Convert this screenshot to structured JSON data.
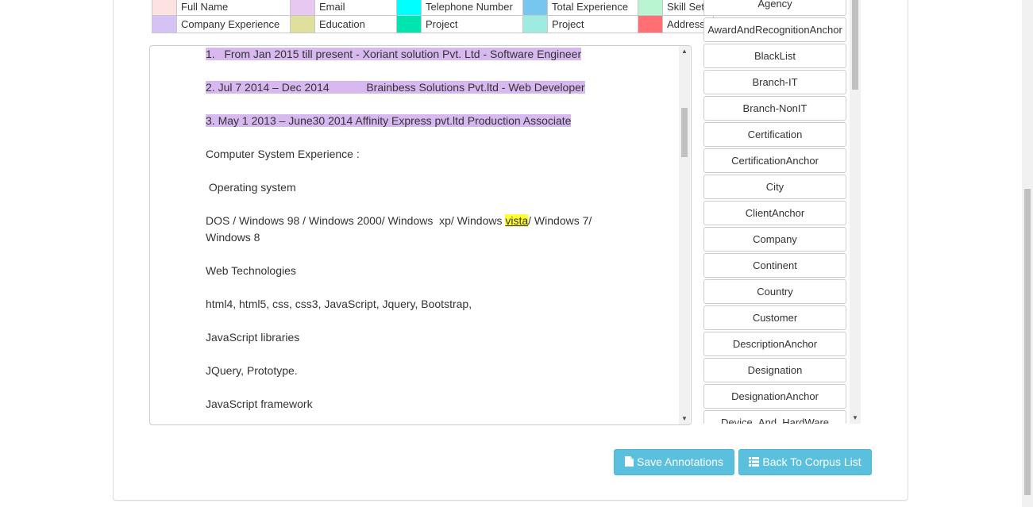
{
  "legend": {
    "rows": [
      [
        {
          "color": "#fde2e2",
          "label": "Full Name"
        },
        {
          "color": "#e6c8f0",
          "label": "Email"
        },
        {
          "color": "#00ffff",
          "label": "Telephone Number"
        },
        {
          "color": "#77c6f0",
          "label": "Total Experience"
        },
        {
          "color": "#b8f5d0",
          "label": "Skill Set"
        }
      ],
      [
        {
          "color": "#d5c3f5",
          "label": "Company Experience"
        },
        {
          "color": "#e0e09e",
          "label": "Education"
        },
        {
          "color": "#00e5b0",
          "label": "Project"
        },
        {
          "color": "#9eece0",
          "label": "Project"
        },
        {
          "color": "#ff7075",
          "label": "Address"
        }
      ]
    ]
  },
  "document": {
    "lines": [
      {
        "parts": [
          {
            "text": "1.   From Jan 2015 till present - Xoriant solution Pvt. Ltd - Software Engineer",
            "hl": "purple"
          }
        ]
      },
      {
        "parts": [
          {
            "text": "2. Jul 7 2014 – Dec 2014            Brainbess Solutions Pvt.ltd - Web Developer",
            "hl": "purple"
          }
        ]
      },
      {
        "parts": [
          {
            "text": "3. May 1 2013 – June30 2014 Affinity Express pvt.ltd Production Associate",
            "hl": "purple"
          }
        ]
      },
      {
        "parts": [
          {
            "text": "Computer System Experience :",
            "hl": ""
          }
        ]
      },
      {
        "parts": [
          {
            "text": " Operating system",
            "hl": ""
          }
        ]
      },
      {
        "parts": [
          {
            "text": "DOS / Windows 98 / Windows 2000/ Windows  xp/ Windows ",
            "hl": ""
          },
          {
            "text": "vista",
            "hl": "yellow"
          },
          {
            "text": "/ Windows 7/",
            "hl": ""
          }
        ]
      },
      {
        "parts": [
          {
            "text": "Windows 8",
            "hl": ""
          }
        ]
      },
      {
        "parts": [
          {
            "text": "Web Technologies",
            "hl": ""
          }
        ]
      },
      {
        "parts": [
          {
            "text": "html4, html5, css, css3, JavaScript, Jquery, Bootstrap,",
            "hl": ""
          }
        ]
      },
      {
        "parts": [
          {
            "text": "JavaScript libraries",
            "hl": ""
          }
        ]
      },
      {
        "parts": [
          {
            "text": "JQuery, Prototype.",
            "hl": ""
          }
        ]
      },
      {
        "parts": [
          {
            "text": "JavaScript framework",
            "hl": ""
          }
        ]
      }
    ]
  },
  "entities": [
    "Agency",
    "AwardAndRecognitionAnchor",
    "BlackList",
    "Branch-IT",
    "Branch-NonIT",
    "Certification",
    "CertificationAnchor",
    "City",
    "ClientAnchor",
    "Company",
    "Continent",
    "Country",
    "Customer",
    "DescriptionAnchor",
    "Designation",
    "DesignationAnchor",
    "Device_And_HardWare"
  ],
  "actions": {
    "save_label": "Save Annotations",
    "back_label": "Back To Corpus List"
  },
  "icons": {
    "scroll_up": "scroll-up-arrow-icon",
    "scroll_down": "scroll-down-arrow-icon",
    "save": "file-icon",
    "back": "list-icon"
  }
}
